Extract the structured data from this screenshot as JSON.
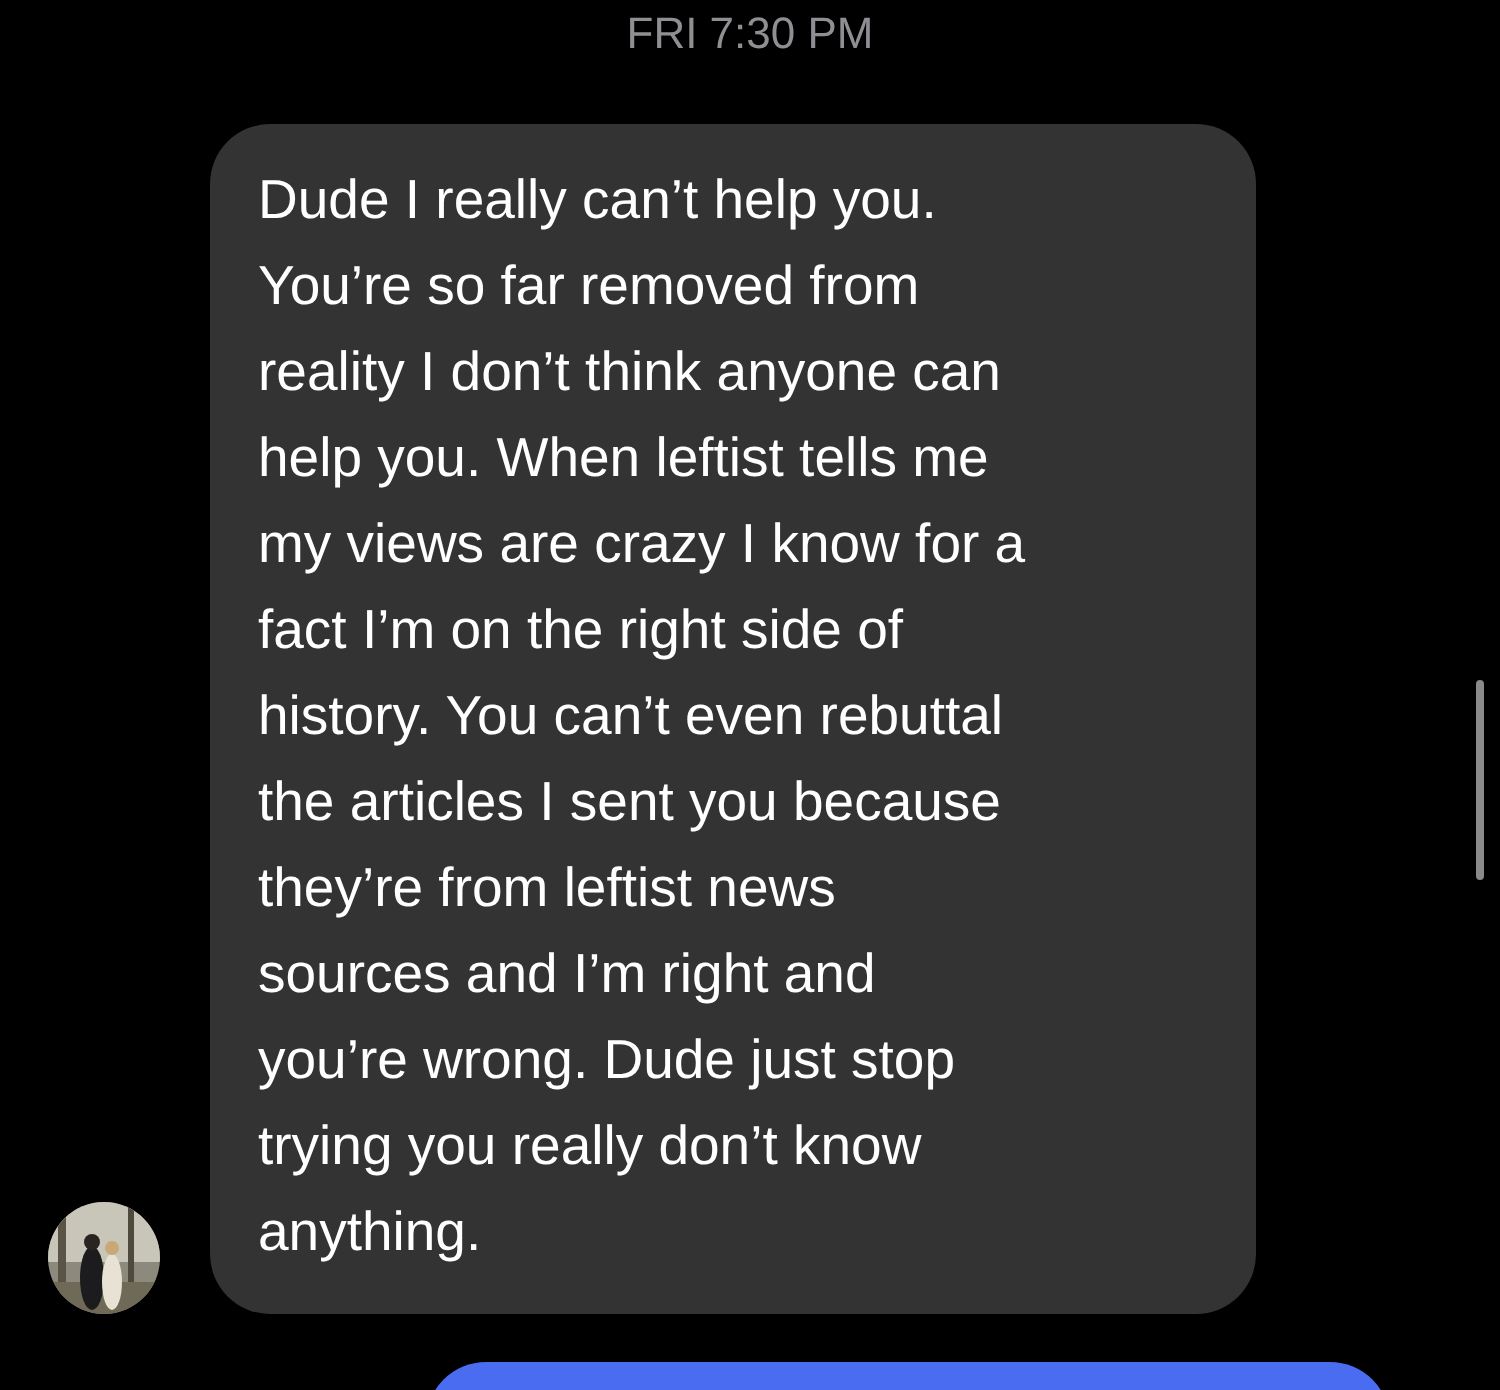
{
  "timestamp": "FRI 7:30 PM",
  "messages": [
    {
      "kind": "received",
      "text": "Dude I really can’t help you.\nYou’re so far removed from\nreality I don’t think anyone can\nhelp you. When leftist tells me\nmy views are crazy I know for a\nfact I’m on the right side of\nhistory. You can’t even rebuttal\nthe articles I sent you because\nthey’re from leftist news\nsources and I’m right and\nyou’re wrong. Dude just stop\ntrying you really don’t know\nanything."
    },
    {
      "kind": "sent"
    }
  ]
}
